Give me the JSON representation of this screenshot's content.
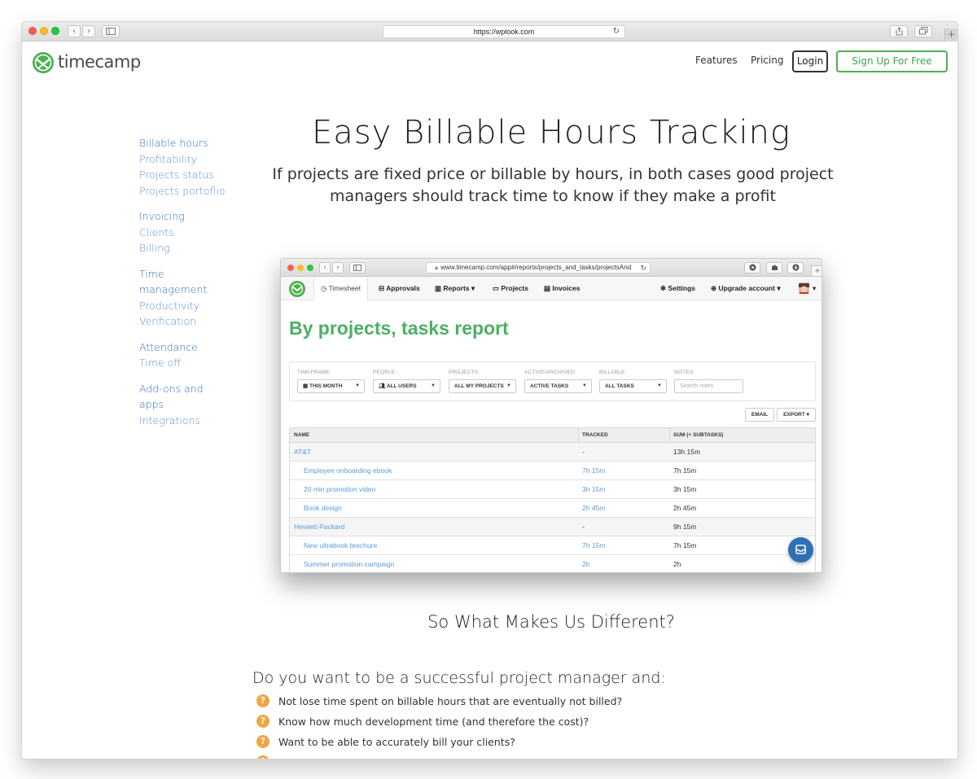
{
  "browser": {
    "url": "https://wplook.com",
    "back_glyph": "‹",
    "forward_glyph": "›",
    "reload_glyph": "↻",
    "new_tab_glyph": "+"
  },
  "header": {
    "logo_text": "timecamp",
    "nav": [
      "Features",
      "Pricing"
    ],
    "login_label": "Login",
    "signup_label": "Sign Up For Free"
  },
  "sidebar": {
    "groups": [
      {
        "items": [
          "Billable hours",
          "Profitability",
          "Projects status",
          "Projects portoflio"
        ]
      },
      {
        "items": [
          "Invoicing",
          "Clients",
          "Billing"
        ]
      },
      {
        "items": [
          "Time",
          "management",
          "Productivity",
          "Verification"
        ]
      },
      {
        "items": [
          "Attendance",
          "Time off"
        ]
      },
      {
        "items": [
          "Add-ons and",
          "apps",
          "Integrations"
        ]
      }
    ]
  },
  "hero": {
    "title": "Easy Billable Hours Tracking",
    "subtitle": "If projects are fixed price or billable by hours, in both cases good project managers should track time to know if they make a profit"
  },
  "screenshot": {
    "url": "www.timecamp.com/app#/reports/projects_and_tasks/projectsAnd",
    "nav": {
      "timesheet": "Timesheet",
      "approvals": "Approvals",
      "reports": "Reports",
      "projects": "Projects",
      "invoices": "Invoices",
      "settings": "Settings",
      "upgrade": "Upgrade account"
    },
    "report_title": "By projects, tasks report",
    "filters": {
      "timeframe_label": "TIMEFRAME:",
      "timeframe_value": "THIS MONTH",
      "people_label": "PEOPLE:",
      "people_value": "ALL USERS",
      "projects_label": "PROJECTS:",
      "projects_value": "ALL MY PROJECTS",
      "active_label": "ACTIVE/ARCHIVED:",
      "active_value": "ACTIVE TASKS",
      "billable_label": "BILLABLE:",
      "billable_value": "ALL TASKS",
      "notes_label": "NOTES:",
      "notes_placeholder": "Search notes"
    },
    "email_label": "EMAIL",
    "export_label": "EXPORT",
    "table": {
      "headers": [
        "NAME",
        "TRACKED",
        "SUM (+ SUBTASKS)"
      ],
      "rows": [
        {
          "name": "AT&T",
          "tracked": "-",
          "sum": "13h 15m",
          "parent": true
        },
        {
          "name": "Employee onboarding ebook",
          "tracked": "7h 15m",
          "sum": "7h 15m",
          "parent": false
        },
        {
          "name": "20 min promotion video",
          "tracked": "3h 15m",
          "sum": "3h 15m",
          "parent": false
        },
        {
          "name": "Book design",
          "tracked": "2h 45m",
          "sum": "2h 45m",
          "parent": false
        },
        {
          "name": "Hewlett-Packard",
          "tracked": "-",
          "sum": "9h 15m",
          "parent": true
        },
        {
          "name": "New ultrabook brechure",
          "tracked": "7h 15m",
          "sum": "7h 15m",
          "parent": false
        },
        {
          "name": "Summer promotion campaign",
          "tracked": "2h",
          "sum": "2h",
          "parent": false
        }
      ]
    }
  },
  "differences": {
    "title": "So What Makes Us Different?",
    "pm_title": "Do you want to be a successful project manager and:",
    "questions": [
      "Not lose time spent on billable hours that are eventually not billed?",
      "Know how much development time (and therefore the cost)?",
      "Want to be able to accurately bill your clients?"
    ]
  },
  "colors": {
    "brand_green": "#4caf50",
    "link_blue": "#5a8fd4",
    "question_orange": "#f0a640"
  }
}
